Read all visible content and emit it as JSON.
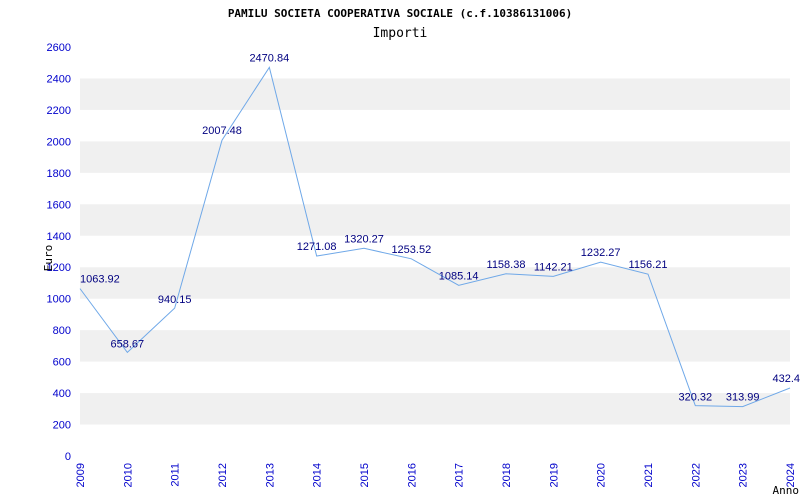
{
  "chart_data": {
    "type": "line",
    "title": "PAMILU SOCIETA COOPERATIVA SOCIALE (c.f.10386131006)",
    "subtitle": "Importi",
    "xlabel": "Anno",
    "ylabel": "Euro",
    "ylim": [
      0,
      2600
    ],
    "ytick_step": 200,
    "grid": true,
    "categories": [
      "2009",
      "2010",
      "2011",
      "2012",
      "2013",
      "2014",
      "2015",
      "2016",
      "2017",
      "2018",
      "2019",
      "2020",
      "2021",
      "2022",
      "2023",
      "2024"
    ],
    "values": [
      1063.92,
      658.67,
      940.15,
      2007.48,
      2470.84,
      1271.08,
      1320.27,
      1253.52,
      1085.14,
      1158.38,
      1142.21,
      1232.27,
      1156.21,
      320.32,
      313.99,
      432.4
    ],
    "value_labels": [
      "1063.92",
      "658.67",
      "940.15",
      "2007.48",
      "2470.84",
      "1271.08",
      "1320.27",
      "1253.52",
      "1085.14",
      "1158.38",
      "1142.21",
      "1232.27",
      "1156.21",
      "320.32",
      "313.99",
      "432.4"
    ]
  },
  "colors": {
    "line": "#6fa8e8",
    "band": "#f0f0f0",
    "tick_text": "#0000cc",
    "label_text": "#000080"
  }
}
